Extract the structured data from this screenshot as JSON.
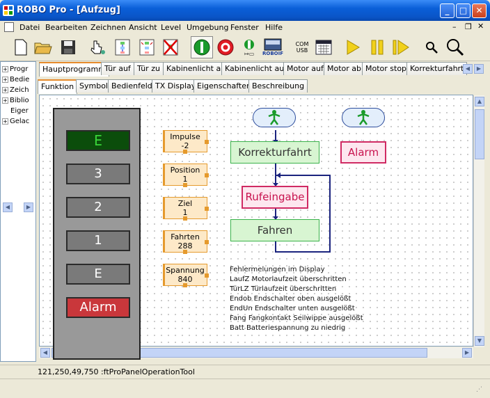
{
  "window": {
    "title": "ROBO Pro - [Aufzug]"
  },
  "menu": {
    "items": [
      "Datei",
      "Bearbeiten",
      "Zeichnen",
      "Ansicht",
      "Level",
      "Umgebung",
      "Fenster",
      "Hilfe"
    ]
  },
  "toolbar": {
    "icons": [
      "new-file-icon",
      "open-folder-icon",
      "save-icon",
      "pointer-tool-icon",
      "subprogram-icon",
      "insert-subprogram-icon",
      "delete-icon",
      "start-icon",
      "stop-icon",
      "step-icon",
      "robo-if-icon",
      "com-usb-icon",
      "calendar-icon",
      "play-icon",
      "pause-icon",
      "step-forward-icon",
      "zoom-in-icon",
      "zoom-out-icon"
    ],
    "robo_if_label": "ROBOIF",
    "com_label": "COM",
    "usb_label": "USB"
  },
  "tree": {
    "items": [
      "Progr",
      "Bedie",
      "Zeich",
      "Biblio",
      "Eiger",
      "Gelac"
    ]
  },
  "tabs": {
    "program_tabs": [
      "Hauptprogramm",
      "Tür auf",
      "Tür zu",
      "Kabinenlicht an",
      "Kabinenlicht aus",
      "Motor auf",
      "Motor ab",
      "Motor stop",
      "Korrekturfahrt"
    ],
    "active_program_tab": "Hauptprogramm",
    "view_tabs": [
      "Funktion",
      "Symbol",
      "Bedienfeld",
      "TX Display",
      "Eigenschaften",
      "Beschreibung"
    ],
    "active_view_tab": "Funktion"
  },
  "panel": {
    "display": "E",
    "buttons": [
      "3",
      "2",
      "1",
      "E",
      "Alarm"
    ]
  },
  "variables": [
    {
      "name": "Impulse",
      "value": "-2"
    },
    {
      "name": "Position",
      "value": "1"
    },
    {
      "name": "Ziel",
      "value": "1"
    },
    {
      "name": "Fahrten",
      "value": "288"
    },
    {
      "name": "Spannung",
      "value": "840"
    }
  ],
  "flow": {
    "korrekturfahrt": "Korrekturfahrt",
    "alarm": "Alarm",
    "rufeingabe": "Rufeingabe",
    "fahren": "Fahren"
  },
  "legend": [
    "Fehlermelungen im Display",
    "LaufZ Motorlaufzeit überschritten",
    "TürLZ Türlaufzeit überschritten",
    "Endob Endschalter oben ausgelößt",
    "EndUn Endschalter unten ausgelößt",
    "Fang Fangkontakt Seilwippe ausgelößt",
    "Batt Batteriespannung zu niedrig"
  ],
  "status": {
    "text": "121,250,49,750 :ftProPanelOperationTool"
  },
  "colors": {
    "titlebar": "#0a5fd8",
    "accent_tab": "#e68b2c",
    "green_box": "#39b24a",
    "red_box": "#d02a63",
    "var_orange": "#e59a2d",
    "display_green": "#0b4d0b"
  }
}
